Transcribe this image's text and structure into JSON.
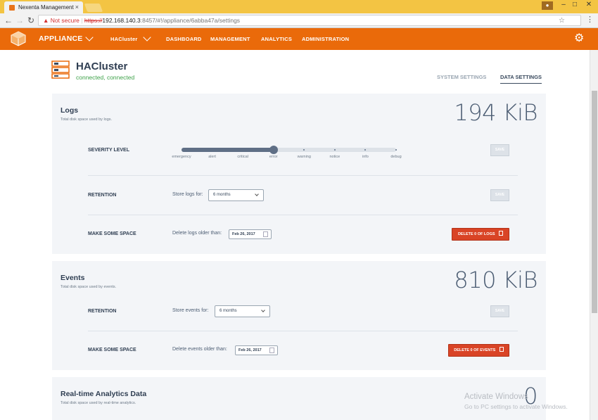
{
  "browser": {
    "tab_title": "Nexenta Management",
    "security_label": "Not secure",
    "url_scheme": "https://",
    "url_host": "192.168.140.3",
    "url_rest": ":8457/#!/appliance/6abba47a/settings"
  },
  "nav": {
    "appliance": "APPLIANCE",
    "cluster": "HACluster",
    "items": [
      "DASHBOARD",
      "MANAGEMENT",
      "ANALYTICS",
      "ADMINISTRATION"
    ],
    "active": "ADMINISTRATION"
  },
  "header": {
    "title": "HACluster",
    "status": "connected, connected",
    "tabs": [
      "SYSTEM SETTINGS",
      "DATA SETTINGS"
    ],
    "active_tab": "DATA SETTINGS"
  },
  "logs": {
    "title": "Logs",
    "subtitle": "Total disk space used by logs.",
    "size": "194 KiB",
    "severity_label": "SEVERITY LEVEL",
    "severity_levels": [
      "emergency",
      "alert",
      "critical",
      "error",
      "warning",
      "notice",
      "info",
      "debug"
    ],
    "severity_selected": "error",
    "retention_label": "RETENTION",
    "retention_desc": "Store logs for:",
    "retention_value": "6 months",
    "space_label": "MAKE SOME SPACE",
    "space_desc": "Delete logs older than:",
    "date_value": "Feb 26, 2017",
    "save_label": "SAVE",
    "delete_pre": "DELETE",
    "delete_count": "0",
    "delete_post": "OF LOGS"
  },
  "events": {
    "title": "Events",
    "subtitle": "Total disk space used by events.",
    "size": "810 KiB",
    "retention_label": "RETENTION",
    "retention_desc": "Store events for:",
    "retention_value": "6 months",
    "space_label": "MAKE SOME SPACE",
    "space_desc": "Delete events older than:",
    "date_value": "Feb 26, 2017",
    "save_label": "SAVE",
    "delete_pre": "DELETE",
    "delete_count": "0",
    "delete_post": "OF EVENTS"
  },
  "analytics": {
    "title": "Real-time Analytics Data",
    "subtitle": "Total disk space used by real-time analytics.",
    "size": "0"
  },
  "watermark": {
    "line1": "Activate Windows",
    "line2": "Go to PC settings to activate Windows."
  },
  "colors": {
    "brand": "#ea6a0a",
    "success": "#3fa24a",
    "danger": "#d94426"
  }
}
